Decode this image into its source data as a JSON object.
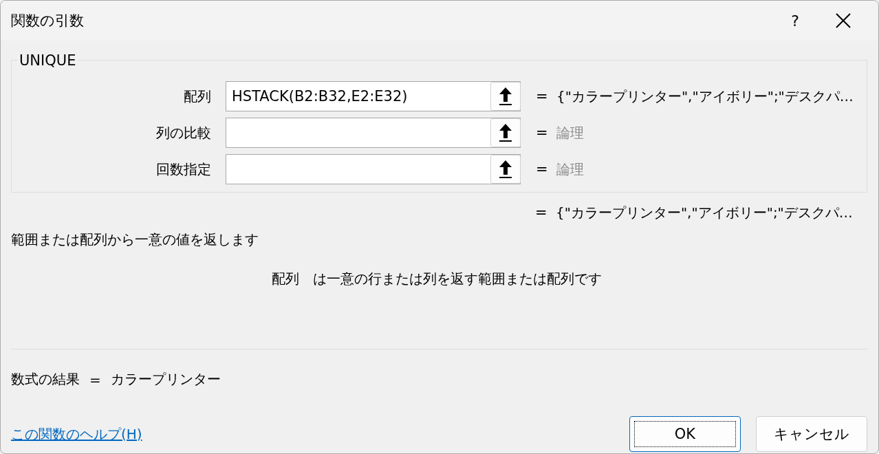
{
  "window": {
    "title": "関数の引数",
    "help_button": "?"
  },
  "function_group": {
    "name": "UNIQUE",
    "arguments": [
      {
        "label": "配列",
        "value": "HSTACK(B2:B32,E2:E32)",
        "equals": "=",
        "result": "{\"カラープリンター\",\"アイボリー\";\"デスクパ…",
        "dimmed": false
      },
      {
        "label": "列の比較",
        "equals": "=",
        "result": "論理",
        "dimmed": true
      },
      {
        "label": "回数指定",
        "equals": "=",
        "result": "論理",
        "dimmed": true
      }
    ]
  },
  "function_result": {
    "equals": "=",
    "value": "{\"カラープリンター\",\"アイボリー\";\"デスクパ…"
  },
  "description": "範囲または配列から一意の値を返します",
  "argument_help": {
    "name": "配列",
    "text": "は一意の行または列を返す範囲または配列です"
  },
  "formula_result": {
    "label": "数式の結果",
    "equals": "=",
    "value": "カラープリンター"
  },
  "help_link": "この関数のヘルプ(H)",
  "buttons": [
    {
      "label": "OK",
      "kind": "default"
    },
    {
      "label": "キャンセル",
      "kind": "normal"
    }
  ]
}
